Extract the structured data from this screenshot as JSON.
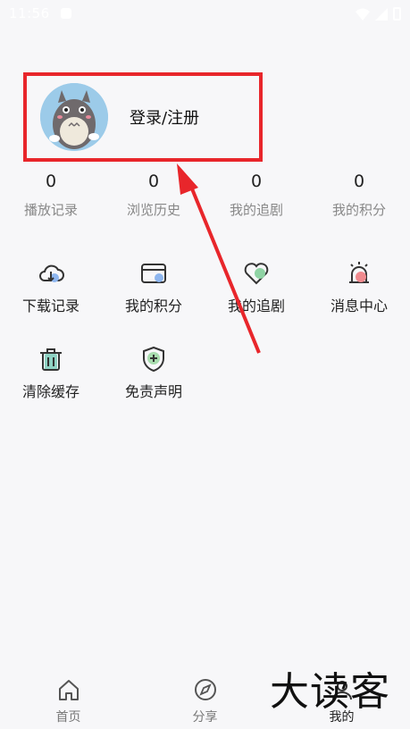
{
  "status_bar": {
    "time": "11:56"
  },
  "profile": {
    "login_label": "登录/注册"
  },
  "stats": [
    {
      "count": "0",
      "label": "播放记录"
    },
    {
      "count": "0",
      "label": "浏览历史"
    },
    {
      "count": "0",
      "label": "我的追剧"
    },
    {
      "count": "0",
      "label": "我的积分"
    }
  ],
  "grid": [
    {
      "label": "下载记录",
      "icon": "cloud-download-icon"
    },
    {
      "label": "我的积分",
      "icon": "card-icon"
    },
    {
      "label": "我的追剧",
      "icon": "heart-icon"
    },
    {
      "label": "消息中心",
      "icon": "alarm-icon"
    },
    {
      "label": "清除缓存",
      "icon": "trash-icon"
    },
    {
      "label": "免责声明",
      "icon": "shield-icon"
    }
  ],
  "bottom_nav": [
    {
      "label": "首页",
      "icon": "home-icon"
    },
    {
      "label": "分享",
      "icon": "compass-icon"
    },
    {
      "label": "我的",
      "icon": "user-icon"
    }
  ],
  "watermark": "大读客",
  "colors": {
    "highlight": "#e8262b",
    "background": "#f7f7f9",
    "avatar_bg": "#9ccbe9"
  }
}
